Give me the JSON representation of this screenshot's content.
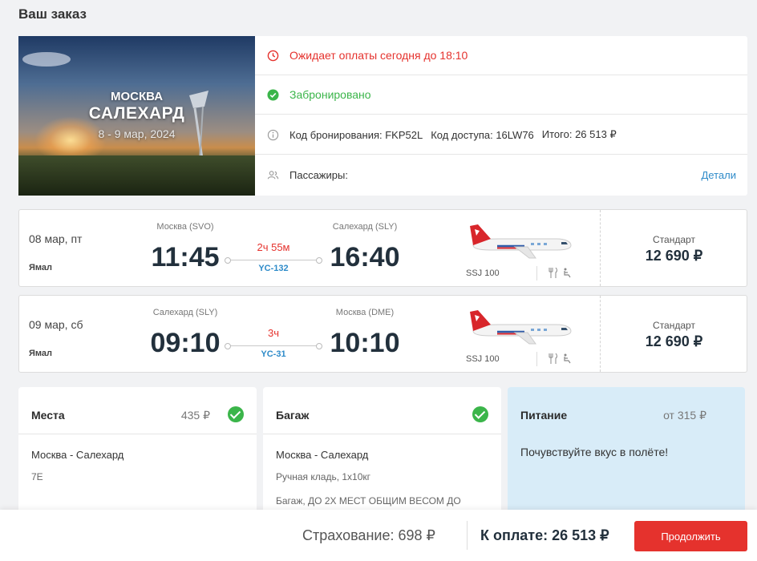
{
  "page": {
    "title": "Ваш заказ"
  },
  "hero": {
    "from": "МОСКВА",
    "to": "САЛЕХАРД",
    "dates": "8 - 9 мар, 2024"
  },
  "status": {
    "payment_deadline": "Ожидает оплаты сегодня до 18:10",
    "booked": "Забронировано",
    "booking_code": "Код бронирования: FKP52L",
    "access_code": "Код доступа: 16LW76",
    "total": "Итого:  26 513 ₽",
    "passengers_label": "Пассажиры:",
    "details_link": "Детали"
  },
  "flights": [
    {
      "date": "08 мар, пт",
      "airline": "Ямал",
      "dep_city": "Москва (SVO)",
      "dep_time": "11:45",
      "arr_city": "Салехард (SLY)",
      "arr_time": "16:40",
      "duration": "2ч 55м",
      "number": "YC-132",
      "aircraft": "SSJ 100",
      "fare_class": "Стандарт",
      "price": "12 690 ₽"
    },
    {
      "date": "09 мар, сб",
      "airline": "Ямал",
      "dep_city": "Салехард (SLY)",
      "dep_time": "09:10",
      "arr_city": "Москва (DME)",
      "arr_time": "10:10",
      "duration": "3ч",
      "number": "YC-31",
      "aircraft": "SSJ 100",
      "fare_class": "Стандарт",
      "price": "12 690 ₽"
    }
  ],
  "extras": {
    "seats": {
      "title": "Места",
      "price": "435 ₽",
      "route": "Москва - Салехард",
      "value": "7E"
    },
    "baggage": {
      "title": "Багаж",
      "route": "Москва - Салехард",
      "hand": "Ручная кладь,   1x10кг",
      "checked": "Багаж, ДО 2Х МЕСТ ОБЩИМ ВЕСОМ ДО"
    },
    "food": {
      "title": "Питание",
      "price": "от 315 ₽",
      "text": "Почувствуйте вкус в полёте!"
    }
  },
  "footer": {
    "insurance": "Страхование: 698 ₽",
    "to_pay": "К оплате:  26 513 ₽",
    "continue_label": "Продолжить"
  },
  "colors": {
    "accent_red": "#e5322d",
    "success_green": "#3bb54a",
    "link_blue": "#2e8bc9",
    "food_bg": "#d8ecf8"
  }
}
